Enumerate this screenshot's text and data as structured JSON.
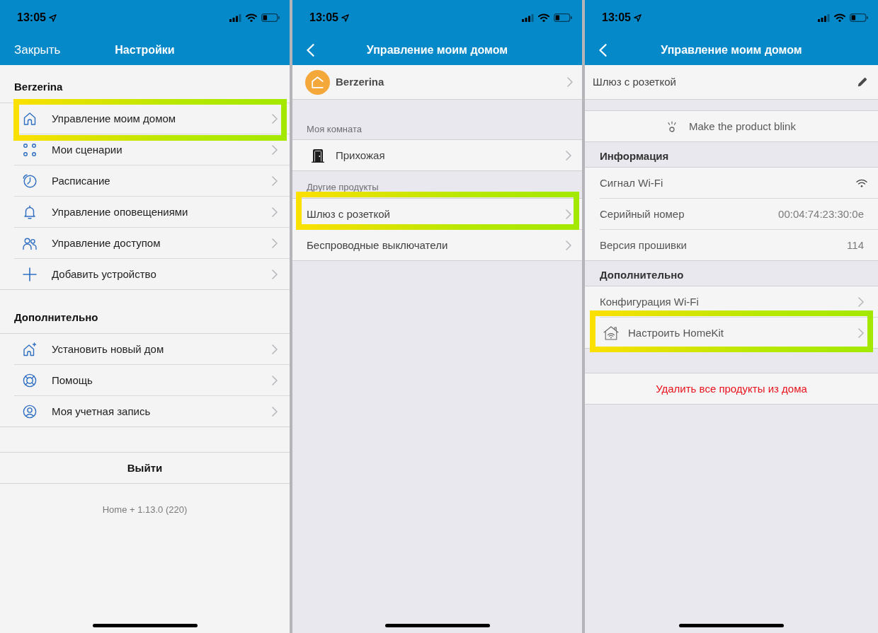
{
  "screens": [
    {
      "kind": "settings",
      "status_bar": {
        "time": "13:05"
      },
      "nav": {
        "left": {
          "kind": "text",
          "label": "Закрыть"
        },
        "title": "Настройки"
      },
      "sections": [
        {
          "title": "Berzerina",
          "items": [
            {
              "label": "Управление моим домом",
              "highlighted": true
            },
            {
              "label": "Мои сценарии",
              "highlighted": false
            },
            {
              "label": "Расписание",
              "highlighted": false
            },
            {
              "label": "Управление оповещениями",
              "highlighted": false
            },
            {
              "label": "Управление доступом",
              "highlighted": false
            },
            {
              "label": "Добавить устройство",
              "highlighted": false
            }
          ]
        },
        {
          "title": "Дополнительно",
          "items": [
            {
              "label": "Установить новый дом",
              "highlighted": false
            },
            {
              "label": "Помощь",
              "highlighted": false
            },
            {
              "label": "Моя учетная запись",
              "highlighted": false
            }
          ]
        }
      ],
      "logout_button": "Выйти",
      "version": "Home + 1.13.0 (220)"
    },
    {
      "kind": "home",
      "status_bar": {
        "time": "13:05"
      },
      "nav": {
        "left": {
          "kind": "back"
        },
        "title": "Управление моим домом"
      },
      "home_row": {
        "label": "Berzerina"
      },
      "sections": [
        {
          "title": "Моя комната",
          "items": [
            {
              "kind": "room",
              "label": "Прихожая",
              "highlighted": false
            }
          ]
        },
        {
          "title": "Другие продукты",
          "items": [
            {
              "kind": "product",
              "label": "Шлюз с розеткой",
              "highlighted": true
            },
            {
              "kind": "product",
              "label": "Беспроводные выключатели",
              "highlighted": false
            }
          ]
        }
      ]
    },
    {
      "kind": "product",
      "status_bar": {
        "time": "13:05"
      },
      "nav": {
        "left": {
          "kind": "back"
        },
        "title": "Управление моим домом"
      },
      "device_row": {
        "label": "Шлюз с розеткой"
      },
      "blink_button": "Make the product blink",
      "sections": [
        {
          "title": "Информация",
          "items": [
            {
              "kind": "signal",
              "label": "Сигнал Wi-Fi"
            },
            {
              "kind": "value",
              "label": "Серийный номер",
              "value": "00:04:74:23:30:0e"
            },
            {
              "kind": "value",
              "label": "Версия прошивки",
              "value": "114"
            }
          ]
        },
        {
          "title": "Дополнительно",
          "items": [
            {
              "kind": "link",
              "label": "Конфигурация Wi-Fi",
              "highlighted": false
            },
            {
              "kind": "icon_link",
              "label": "Настроить HomeKit",
              "highlighted": true
            }
          ]
        }
      ],
      "delete_button": "Удалить все продукты из дома"
    }
  ]
}
